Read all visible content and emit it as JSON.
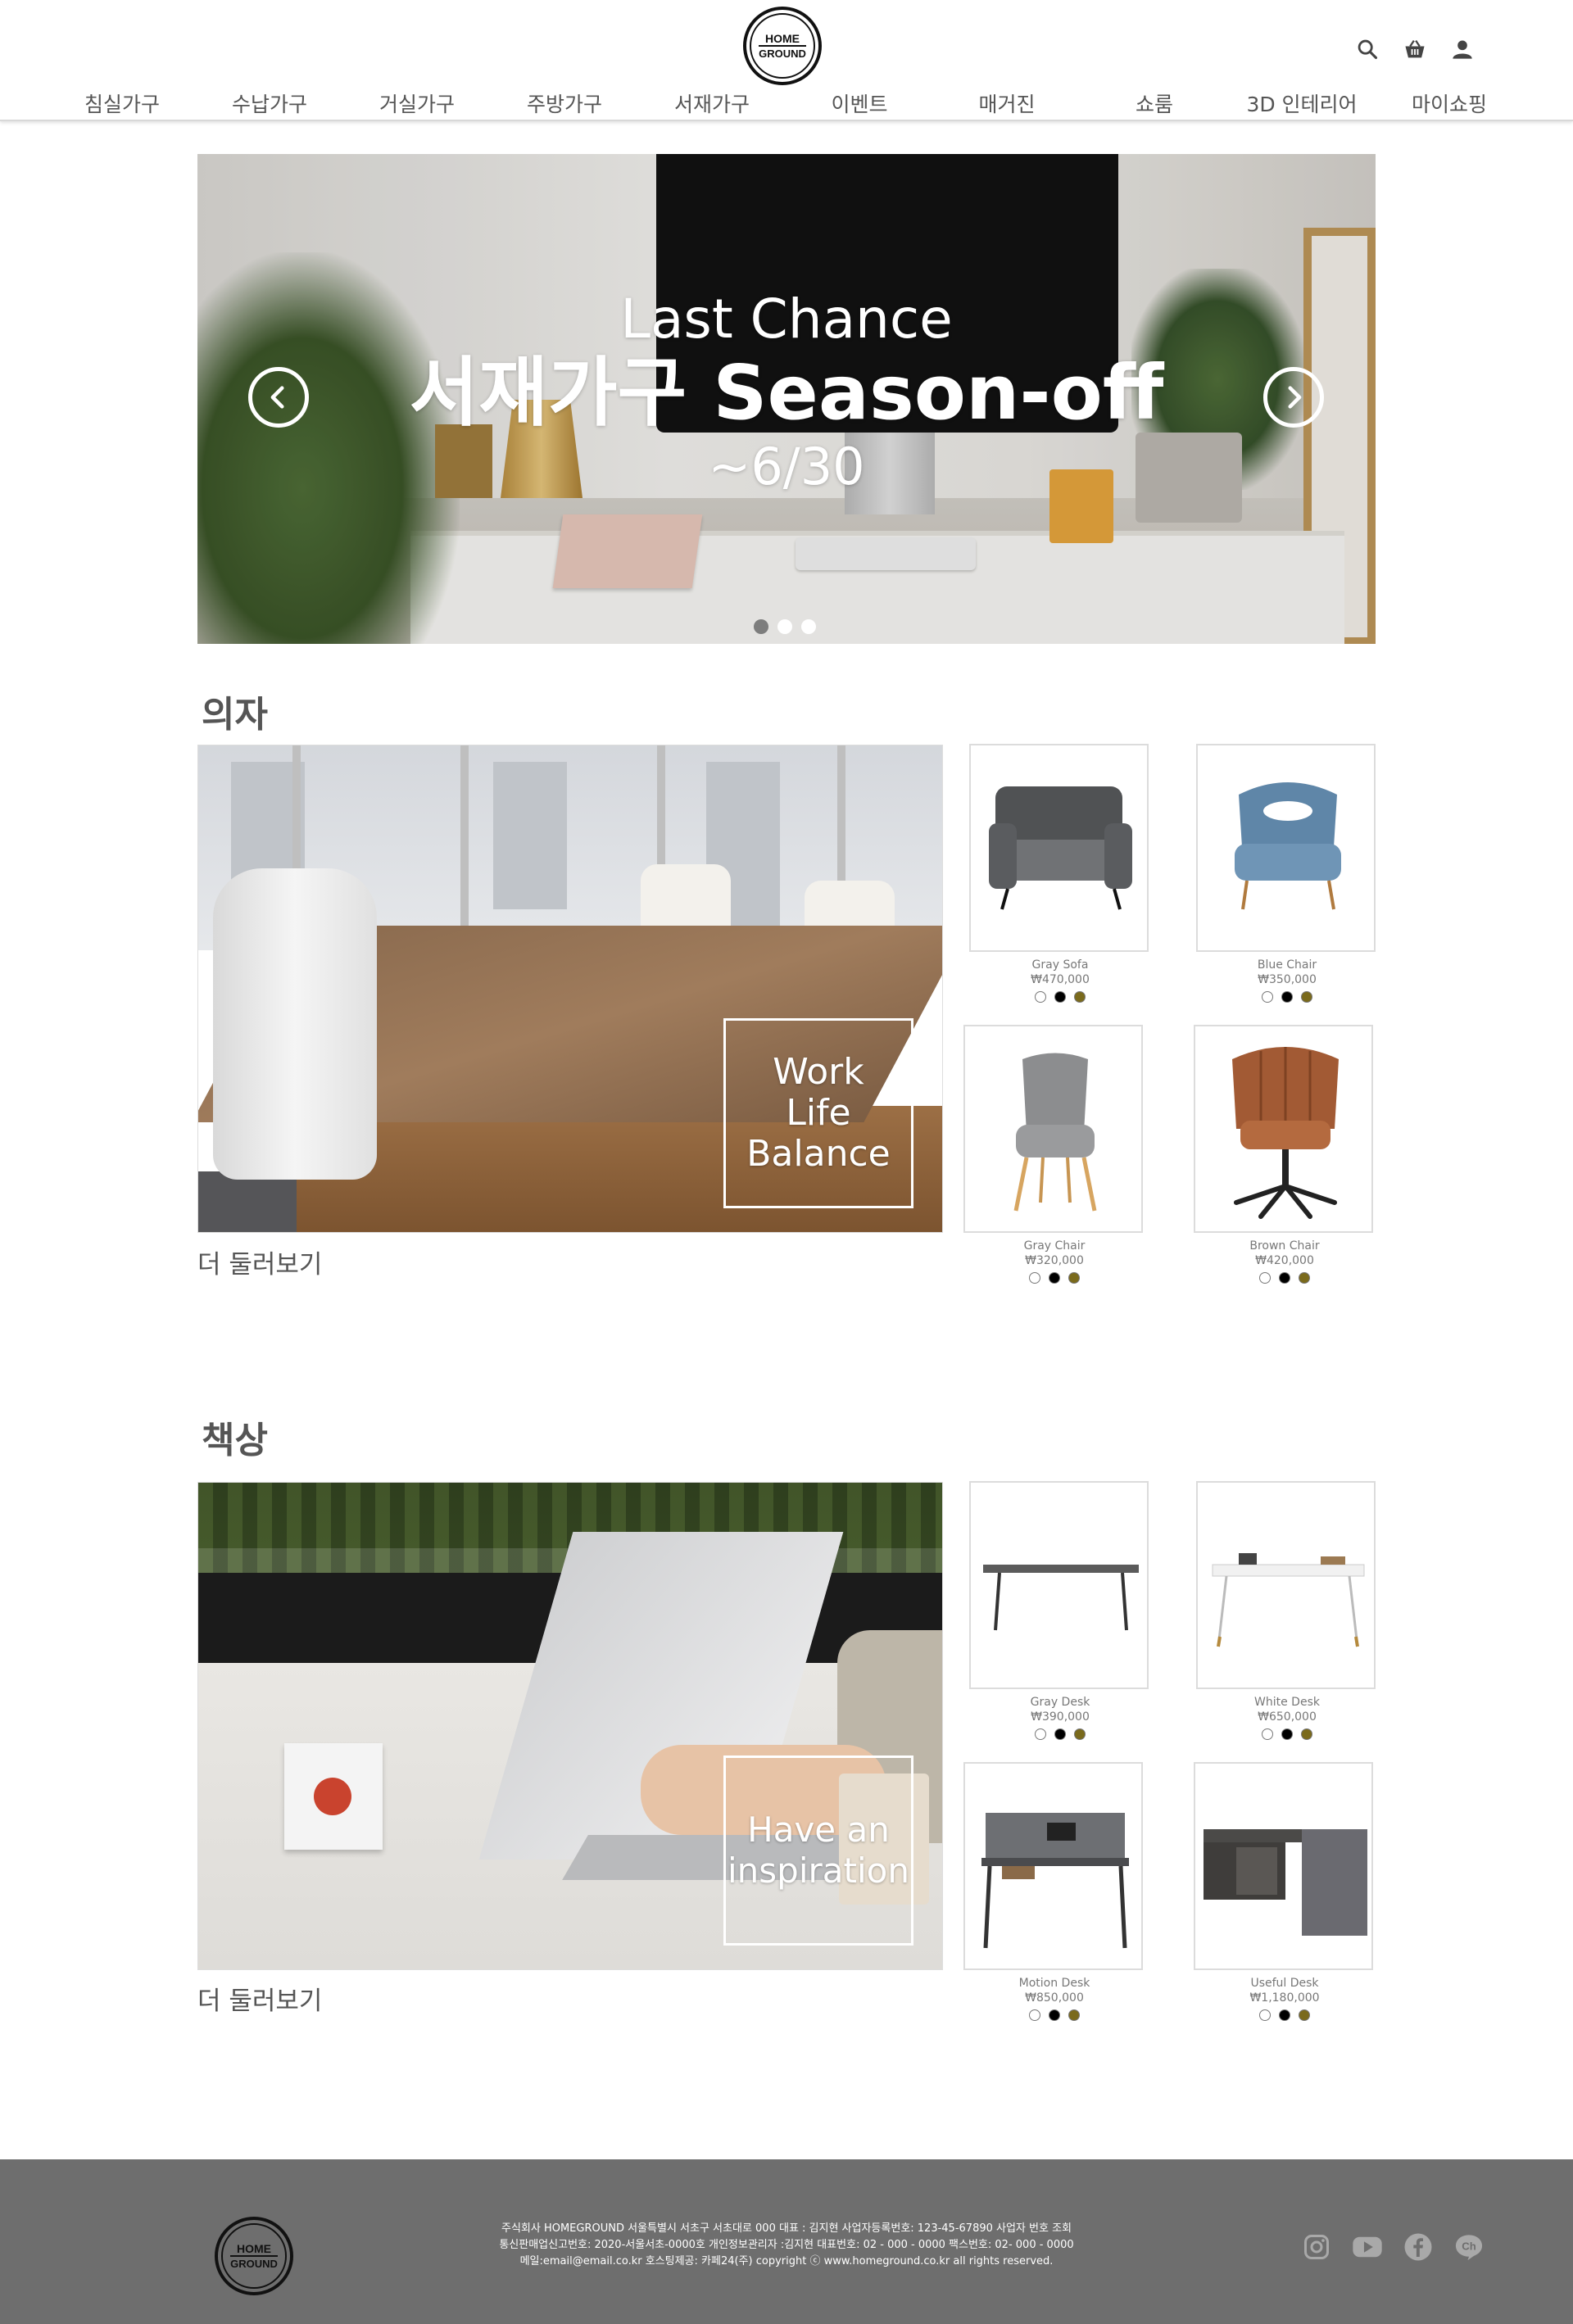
{
  "logo": {
    "line1": "HOME",
    "line2": "GROUND"
  },
  "header": {
    "icons": [
      "search-icon",
      "basket-icon",
      "user-icon"
    ],
    "nav": [
      "침실가구",
      "수납가구",
      "거실가구",
      "주방가구",
      "서재가구",
      "이벤트",
      "매거진",
      "쇼룸",
      "3D 인테리어",
      "마이쇼핑"
    ]
  },
  "hero": {
    "line1": "Last Chance",
    "line2": "서재가구 Season-off",
    "line3": "~6/30",
    "prev_icon": "chevron-left-icon",
    "next_icon": "chevron-right-icon",
    "dots": 3,
    "active_dot": 0
  },
  "sections": [
    {
      "title": "의자",
      "feature_text": [
        "Work",
        "Life",
        "Balance"
      ],
      "more_label": "더 둘러보기",
      "products": [
        {
          "name": "Gray Sofa",
          "price": "₩470,000"
        },
        {
          "name": "Blue Chair",
          "price": "₩350,000"
        },
        {
          "name": "Gray Chair",
          "price": "₩320,000"
        },
        {
          "name": "Brown Chair",
          "price": "₩420,000"
        }
      ]
    },
    {
      "title": "책상",
      "feature_text": [
        "Have an",
        "inspiration"
      ],
      "more_label": "더 둘러보기",
      "products": [
        {
          "name": "Gray Desk",
          "price": "₩390,000"
        },
        {
          "name": "White Desk",
          "price": "₩650,000"
        },
        {
          "name": "Motion Desk",
          "price": "₩850,000"
        },
        {
          "name": "Useful Desk",
          "price": "₩1,180,000"
        }
      ]
    }
  ],
  "swatch_colors": [
    "#ffffff",
    "#000000",
    "#7a6a1c"
  ],
  "footer": {
    "line1": "주식회사 HOMEGROUND 서울특별시 서초구 서초대로 000 대표 : 김지현 사업자등록번호: 123-45-67890 사업자 번호 조회",
    "line2": "통신판매업신고번호: 2020-서울서초-0000호 개인정보관리자 :김지현 대표번호: 02 - 000 - 0000 팩스번호: 02- 000 - 0000",
    "line3": "메일:email@email.co.kr 호스팅제공: 카페24(주) copyright ⓒ www.homeground.co.kr all rights reserved.",
    "social": [
      "instagram-icon",
      "youtube-icon",
      "facebook-icon",
      "kakao-channel-icon"
    ],
    "kakao_label": "Ch"
  },
  "colors": {
    "footer_bg": "#6e6e6e",
    "accent": "#7a6a1c",
    "text": "#555555"
  }
}
